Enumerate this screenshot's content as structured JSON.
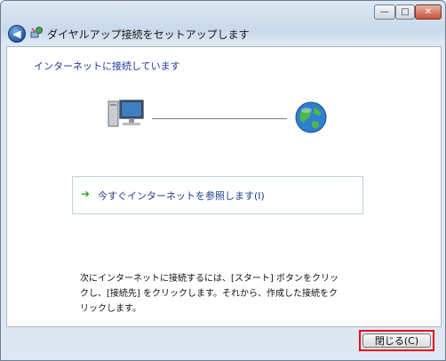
{
  "window": {
    "title": "ダイヤルアップ接続をセットアップします",
    "controls": {
      "minimize": "—",
      "maximize": "□",
      "close": "✕"
    }
  },
  "nav": {
    "back_glyph": "◀"
  },
  "main": {
    "heading": "インターネットに接続しています",
    "link_arrow": "➔",
    "browse_link": "今すぐインターネットを参照します(I)",
    "info_lines": [
      "次にインターネットに接続するには、[スタート] ボタンをクリッ",
      "クし、[接続先] をクリックします。それから、作成した接続をク",
      "リックします。"
    ]
  },
  "footer": {
    "close_label": "閉じる(C)"
  }
}
